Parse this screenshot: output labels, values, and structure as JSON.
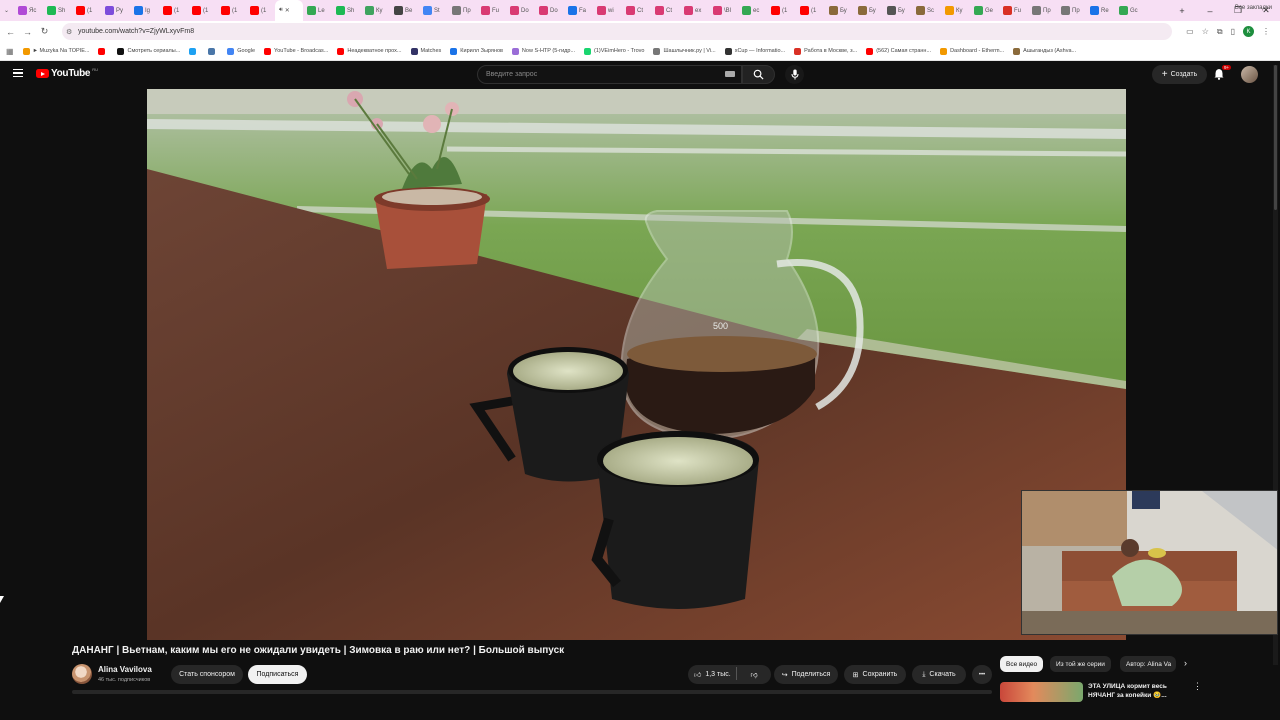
{
  "tabs": [
    {
      "label": "Яс",
      "color": "#b04ad6"
    },
    {
      "label": "Sh",
      "color": "#1db954"
    },
    {
      "label": "(1",
      "color": "#ff0000"
    },
    {
      "label": "Ру",
      "color": "#7d4cdb"
    },
    {
      "label": "Ig",
      "color": "#1a73e8"
    },
    {
      "label": "(1",
      "color": "#ff0000"
    },
    {
      "label": "(1",
      "color": "#ff0000"
    },
    {
      "label": "(1",
      "color": "#ff0000"
    },
    {
      "label": "(1",
      "color": "#ff0000"
    },
    {
      "label": "Le",
      "color": "#34a853"
    },
    {
      "label": "Sh",
      "color": "#1db954"
    },
    {
      "label": "Ку",
      "color": "#3fa35f"
    },
    {
      "label": "Be",
      "color": "#444444"
    },
    {
      "label": "St",
      "color": "#4285f4"
    },
    {
      "label": "Пр",
      "color": "#777777"
    },
    {
      "label": "Fu",
      "color": "#d93a73"
    },
    {
      "label": "Do",
      "color": "#d93a73"
    },
    {
      "label": "Do",
      "color": "#d93a73"
    },
    {
      "label": "Fa",
      "color": "#1a73e8"
    },
    {
      "label": "wi",
      "color": "#d93a73"
    },
    {
      "label": "Ct",
      "color": "#d93a73"
    },
    {
      "label": "Ct",
      "color": "#d93a73"
    },
    {
      "label": "ex",
      "color": "#d93a73"
    },
    {
      "label": "\\Bl",
      "color": "#d93a73"
    },
    {
      "label": "ec",
      "color": "#34a853"
    },
    {
      "label": "(1",
      "color": "#ff0000"
    },
    {
      "label": "(1",
      "color": "#ff0000"
    },
    {
      "label": "Бу",
      "color": "#8a6a3b"
    },
    {
      "label": "Бу",
      "color": "#8a6a3b"
    },
    {
      "label": "Бу",
      "color": "#555555"
    },
    {
      "label": "Sc",
      "color": "#8a6a3b"
    },
    {
      "label": "Ку",
      "color": "#f29900"
    },
    {
      "label": "Ge",
      "color": "#34a853"
    },
    {
      "label": "Fu",
      "color": "#d93025"
    },
    {
      "label": "Пр",
      "color": "#777777"
    },
    {
      "label": "Пр",
      "color": "#777777"
    },
    {
      "label": "Re",
      "color": "#1a73e8"
    },
    {
      "label": "Gc",
      "color": "#34a853"
    }
  ],
  "active_tab_after": 9,
  "window_controls": {
    "minimize": "–",
    "maximize": "❐",
    "close": "✕"
  },
  "omnibar": {
    "url": "youtube.com/watch?v=ZjyWLxyvFm8",
    "back": "←",
    "forward": "→",
    "reload": "↻",
    "profile_letter": "K"
  },
  "bookmarks": [
    {
      "label": "► Muzyka Na TOPIE...",
      "color": "#f29900"
    },
    {
      "label": "",
      "color": "#ff0000"
    },
    {
      "label": "Смотреть сериалы...",
      "color": "#111111"
    },
    {
      "label": "",
      "color": "#1da1f2"
    },
    {
      "label": "",
      "color": "#4a76a8"
    },
    {
      "label": "Google",
      "color": "#4285f4"
    },
    {
      "label": "YouTube - Broadcas...",
      "color": "#ff0000"
    },
    {
      "label": "Неадекватное прох...",
      "color": "#ff0000"
    },
    {
      "label": "Matches",
      "color": "#333366"
    },
    {
      "label": "Кирилл Зырянов",
      "color": "#1a73e8"
    },
    {
      "label": "Now S-HTP (5-гидр...",
      "color": "#9a6dd7"
    },
    {
      "label": "(1)VEimHero - Trovo",
      "color": "#19d56f"
    },
    {
      "label": "Шашлычник.ру | Vi...",
      "color": "#777777"
    },
    {
      "label": "xCup — Informatio...",
      "color": "#333333"
    },
    {
      "label": "Работа в Москве, з...",
      "color": "#d93025"
    },
    {
      "label": "(562) Самая странн...",
      "color": "#ff0000"
    },
    {
      "label": "Dashboard - Etherm...",
      "color": "#f29900"
    },
    {
      "label": "Ашыгандыз (Ashva...",
      "color": "#8a6a3b"
    }
  ],
  "all_bookmarks": "Все закладки",
  "youtube": {
    "logo": "YouTube",
    "region": "RU",
    "search_placeholder": "Введите запрос",
    "create": "Создать",
    "notifications": "9+"
  },
  "video": {
    "title": "ДАНАНГ | Вьетнам, каким мы его не ожидали увидеть | Зимовка в раю или нет? | Большой выпуск",
    "pitcher_mark": "500"
  },
  "channel": {
    "name": "Alina Vavilova",
    "subscribers": "46 тыс. подписчиков",
    "sponsor": "Стать спонсором",
    "subscribe": "Подписаться"
  },
  "actions": {
    "likes": "1,3 тыс.",
    "share": "Поделиться",
    "save": "Сохранить",
    "download": "Скачать",
    "more": "•••"
  },
  "filters": [
    "Все видео",
    "Из той же серии",
    "Автор: Alina Va"
  ],
  "recommendation": {
    "title": "ЭТА УЛИЦА кормит весь НЯЧАНГ за копейки 🥹..."
  },
  "colors": {
    "background": "#0f0f0f",
    "chip_selected": "#f1f1f1",
    "brand_red": "#ff0000",
    "tabstrip": "#f7dff4"
  }
}
